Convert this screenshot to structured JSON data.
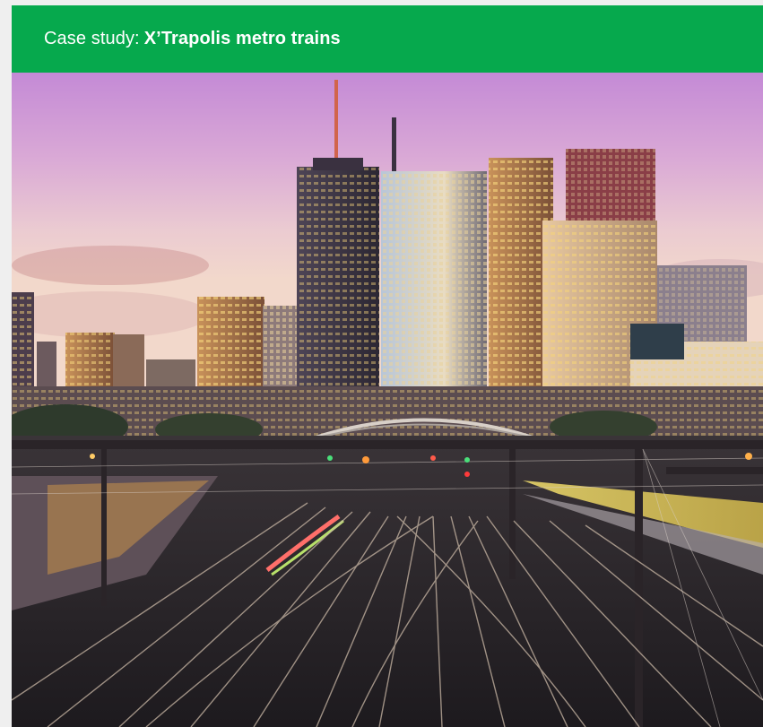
{
  "header": {
    "prefix": "Case study:",
    "title": "X’Trapolis metro trains",
    "background": "#06a94d",
    "text_color": "#ffffff"
  },
  "photo": {
    "subject-icon": "city-skyline-railway-photo"
  }
}
